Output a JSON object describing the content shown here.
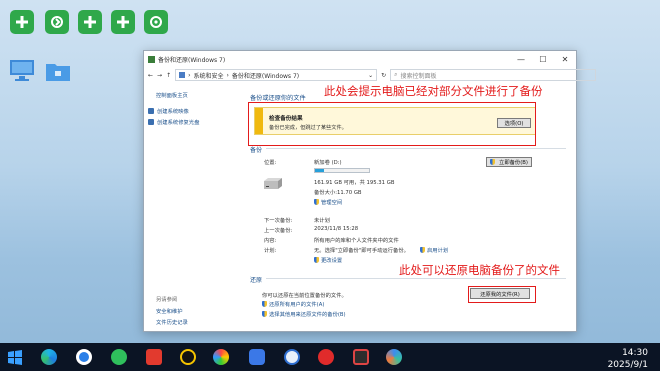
{
  "desktop": {
    "icons": [
      "add-icon",
      "sync-icon",
      "add-icon",
      "add-icon",
      "refresh-icon",
      "monitor-icon",
      "folder-icon"
    ]
  },
  "window": {
    "title": "备份和还原(Windows 7)",
    "breadcrumb": [
      "系统和安全",
      "备份和还原(Windows 7)"
    ],
    "search_placeholder": "搜索控制面板",
    "sidebar": {
      "home": "控制面板主页",
      "items": [
        "创建系统映像",
        "创建系统修复光盘"
      ],
      "see_also": "另请参阅",
      "links": [
        "安全和维护",
        "文件历史记录"
      ]
    },
    "main": {
      "heading": "备份或还原你的文件",
      "notice_title": "检查备份结果",
      "notice_text": "备份已完成，但跳过了某些文件。",
      "options_button": "选项(O)",
      "backup_section": "备份",
      "location_label": "位置:",
      "location_value": "新加卷 (D:)",
      "free_space": "161.91 GB 可用，共 195.31 GB",
      "backup_size": "备份大小:11.70 GB",
      "manage_space": "管理空间",
      "backup_now_button": "立即备份(B)",
      "disk_usage_fraction": 0.17,
      "next_backup_label": "下一次备份:",
      "next_backup_value": "未计划",
      "last_backup_label": "上一次备份:",
      "last_backup_value": "2023/11/8 15:28",
      "contents_label": "内容:",
      "contents_value": "所有用户的库和个人文件夹中的文件",
      "schedule_label": "计划:",
      "schedule_value": "无。选择\"立即备份\"即可手动运行备份。",
      "enable_schedule": "启用计划",
      "change_settings": "更改设置",
      "restore_section": "还原",
      "restore_text": "你可以还原在当前位置备份的文件。",
      "restore_my_files_button": "还原我的文件(R)",
      "restore_all_users": "还原所有用户的文件(A)",
      "select_other_backup": "选择其他用来还原文件的备份(B)"
    }
  },
  "annotations": {
    "top": "此处会提示电脑已经对部分文件进行了备份",
    "bottom": "此处可以还原电脑备份了的文件"
  },
  "taskbar": {
    "icons": [
      "windows-start-icon",
      "edge-icon",
      "chrome-icon",
      "wechat-icon",
      "netease-icon",
      "qq-icon",
      "photos-icon",
      "feishu-icon",
      "sogou-icon",
      "netease-music-icon",
      "game-icon",
      "baidu-netdisk-icon"
    ],
    "time": "14:30",
    "date": "2025/9/1"
  },
  "colors": {
    "accent": "#1a4f8a",
    "annotation": "#e31b1b",
    "notice_bar": "#f0b90f"
  }
}
